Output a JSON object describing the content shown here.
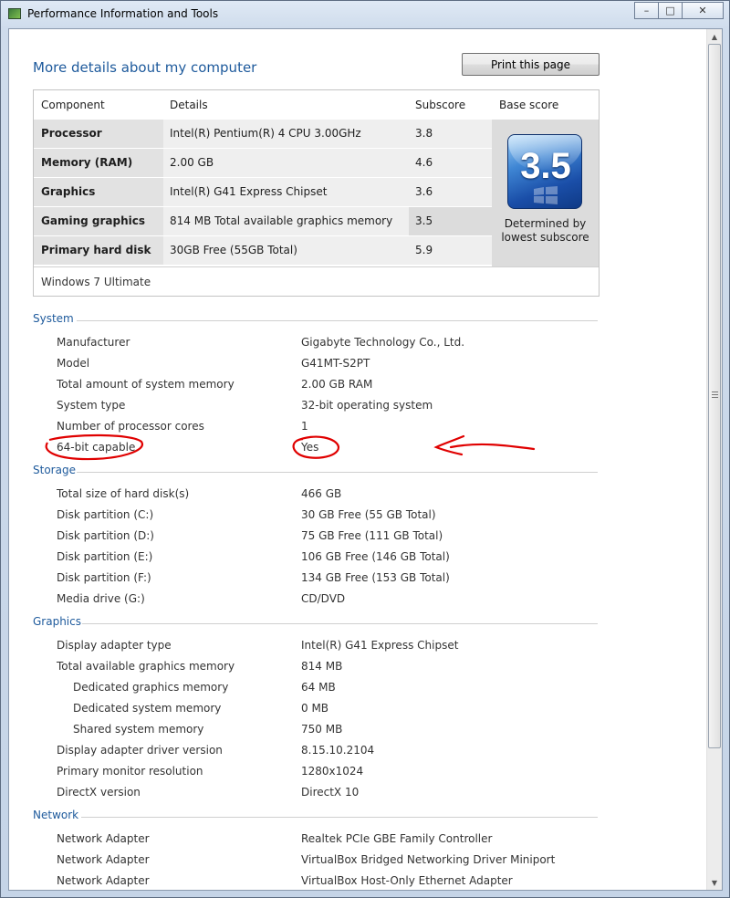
{
  "window": {
    "title": "Performance Information and Tools",
    "minimize_glyph": "–",
    "maximize_glyph": "□",
    "close_glyph": "✕"
  },
  "page": {
    "heading": "More details about my computer",
    "print_label": "Print this page"
  },
  "score_table": {
    "headers": {
      "component": "Component",
      "details": "Details",
      "subscore": "Subscore",
      "base": "Base score"
    },
    "rows": [
      {
        "component": "Processor",
        "details": "Intel(R) Pentium(R) 4 CPU 3.00GHz",
        "subscore": "3.8"
      },
      {
        "component": "Memory (RAM)",
        "details": "2.00 GB",
        "subscore": "4.6"
      },
      {
        "component": "Graphics",
        "details": "Intel(R) G41 Express Chipset",
        "subscore": "3.6"
      },
      {
        "component": "Gaming graphics",
        "details": "814 MB Total available graphics memory",
        "subscore": "3.5"
      },
      {
        "component": "Primary hard disk",
        "details": "30GB Free (55GB Total)",
        "subscore": "5.9"
      }
    ],
    "base_score": "3.5",
    "base_note_line1": "Determined by",
    "base_note_line2": "lowest subscore",
    "os": "Windows 7 Ultimate"
  },
  "system": {
    "title": "System",
    "items": [
      {
        "label": "Manufacturer",
        "value": "Gigabyte Technology Co., Ltd."
      },
      {
        "label": "Model",
        "value": "G41MT-S2PT"
      },
      {
        "label": "Total amount of system memory",
        "value": "2.00 GB RAM"
      },
      {
        "label": "System type",
        "value": "32-bit operating system"
      },
      {
        "label": "Number of processor cores",
        "value": "1"
      },
      {
        "label": "64-bit capable",
        "value": "Yes"
      }
    ]
  },
  "storage": {
    "title": "Storage",
    "items": [
      {
        "label": "Total size of hard disk(s)",
        "value": "466 GB"
      },
      {
        "label": "Disk partition (C:)",
        "value": "30 GB Free (55 GB Total)"
      },
      {
        "label": "Disk partition (D:)",
        "value": "75 GB Free (111 GB Total)"
      },
      {
        "label": "Disk partition (E:)",
        "value": "106 GB Free (146 GB Total)"
      },
      {
        "label": "Disk partition (F:)",
        "value": "134 GB Free (153 GB Total)"
      },
      {
        "label": "Media drive (G:)",
        "value": "CD/DVD"
      }
    ]
  },
  "graphics": {
    "title": "Graphics",
    "items": [
      {
        "label": "Display adapter type",
        "value": "Intel(R) G41 Express Chipset"
      },
      {
        "label": "Total available graphics memory",
        "value": "814 MB"
      },
      {
        "label": "Dedicated graphics memory",
        "value": "64 MB"
      },
      {
        "label": "Dedicated system memory",
        "value": "0 MB"
      },
      {
        "label": "Shared system memory",
        "value": "750 MB"
      },
      {
        "label": "Display adapter driver version",
        "value": "8.15.10.2104"
      },
      {
        "label": "Primary monitor resolution",
        "value": "1280x1024"
      },
      {
        "label": "DirectX version",
        "value": "DirectX 10"
      }
    ]
  },
  "network": {
    "title": "Network",
    "items": [
      {
        "label": "Network Adapter",
        "value": "Realtek PCIe GBE Family Controller"
      },
      {
        "label": "Network Adapter",
        "value": "VirtualBox Bridged Networking Driver Miniport"
      },
      {
        "label": "Network Adapter",
        "value": "VirtualBox Host-Only Ethernet Adapter"
      }
    ]
  },
  "colors": {
    "heading_blue": "#1e5a9c",
    "annotation_red": "#e00000",
    "score_tile_blue": "#1a4ea8"
  }
}
